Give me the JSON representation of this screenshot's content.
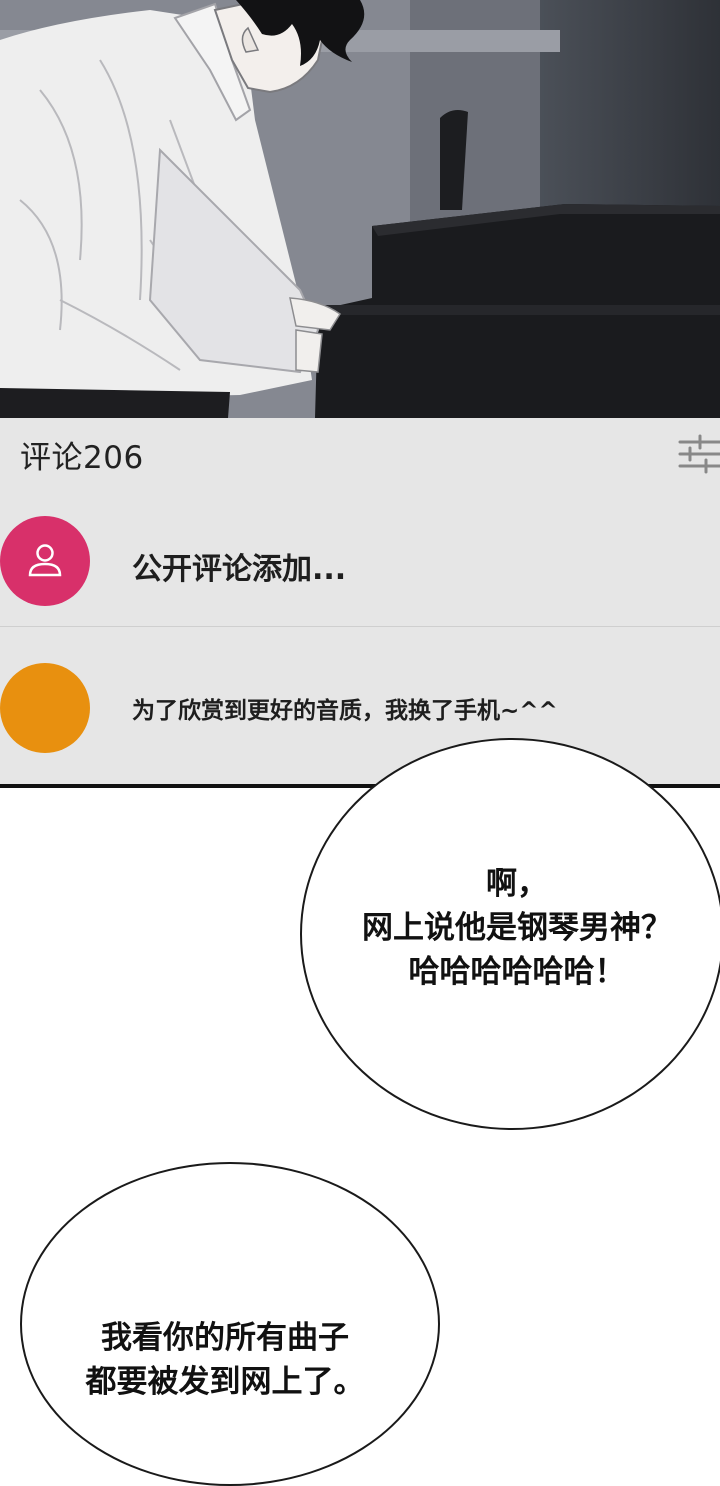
{
  "comments": {
    "title": "评论206",
    "add_placeholder": "公开评论添加...",
    "items": [
      {
        "text": "为了欣赏到更好的音质，我换了手机~^^"
      }
    ]
  },
  "bubbles": [
    {
      "text": "啊，\n网上说他是钢琴男神？\n哈哈哈哈哈哈！"
    },
    {
      "text": "我看你的所有曲子\n都要被发到网上了。"
    }
  ],
  "colors": {
    "comments_bg": "#e6e6e6",
    "add_avatar": "#d8306a",
    "comment_avatar": "#e8900f"
  },
  "icons": {
    "filter": "sliders-filter-icon",
    "user": "user-icon"
  }
}
